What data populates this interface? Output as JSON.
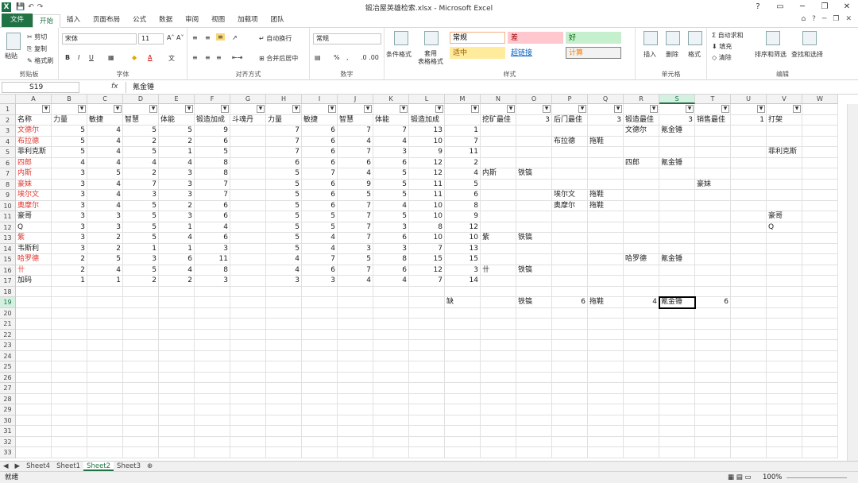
{
  "window": {
    "title": "锻冶屋英雄检索.xlsx - Microsoft Excel",
    "app_icon": "X"
  },
  "quick_access": {
    "save": "💾",
    "undo": "↶",
    "redo": "↷"
  },
  "tabs": [
    "文件",
    "开始",
    "插入",
    "页面布局",
    "公式",
    "数据",
    "审阅",
    "视图",
    "加载项",
    "团队"
  ],
  "ribbon": {
    "clipboard": {
      "label": "剪贴板",
      "paste": "粘贴",
      "cut": "剪切",
      "copy": "复制",
      "format_painter": "格式刷"
    },
    "font": {
      "label": "字体",
      "name": "宋体",
      "size": "11"
    },
    "alignment": {
      "label": "对齐方式",
      "wrap": "自动换行",
      "merge": "合并后居中"
    },
    "number": {
      "label": "数字",
      "format": "常规"
    },
    "styles": {
      "label": "样式",
      "conditional": "条件格式",
      "table": "套用\n表格格式",
      "items": [
        {
          "text": "常规",
          "bg": "#ffffff",
          "color": "#000000",
          "border": "#f4b183"
        },
        {
          "text": "差",
          "bg": "#ffc7ce",
          "color": "#9c0006",
          "border": "#ffc7ce"
        },
        {
          "text": "好",
          "bg": "#c6efce",
          "color": "#006100",
          "border": "#c6efce"
        },
        {
          "text": "适中",
          "bg": "#ffeb9c",
          "color": "#9c5700",
          "border": "#ffeb9c"
        },
        {
          "text": "超链接",
          "bg": "#ffffff",
          "color": "#0563c1",
          "border": "#ffffff"
        },
        {
          "text": "计算",
          "bg": "#f2f2f2",
          "color": "#fa7d00",
          "border": "#7f7f7f"
        }
      ]
    },
    "cells": {
      "label": "单元格",
      "insert": "插入",
      "delete": "删除",
      "format": "格式"
    },
    "editing": {
      "label": "编辑",
      "autosum": "自动求和",
      "fill": "填充",
      "clear": "清除",
      "sort": "排序和筛选",
      "find": "查找和选择"
    }
  },
  "formula_bar": {
    "name_box": "S19",
    "fx": "fx",
    "content": "氪金锤"
  },
  "columns": [
    "A",
    "B",
    "C",
    "D",
    "E",
    "F",
    "G",
    "H",
    "I",
    "J",
    "K",
    "L",
    "M",
    "N",
    "O",
    "P",
    "Q",
    "R",
    "S",
    "T",
    "U",
    "V",
    "W"
  ],
  "selected_col": "S",
  "rows": [
    {
      "r": 1,
      "cells": {}
    },
    {
      "r": 2,
      "cells": {
        "A": "名称",
        "B": "力量",
        "C": "敏捷",
        "D": "智慧",
        "E": "体能",
        "F": "锻造加成",
        "G": "斗魂丹",
        "H": "力量",
        "I": "敏捷",
        "J": "智慧",
        "K": "体能",
        "L": "锻造加成",
        "N": "挖矿最佳",
        "O": "3",
        "P": "后门最佳",
        "Q": "3",
        "R": "锻造最佳",
        "S": "3",
        "T": "销售最佳",
        "U": "1",
        "V": "打架"
      }
    },
    {
      "r": 3,
      "cells": {
        "A": "文德尔",
        "B": "5",
        "C": "4",
        "D": "5",
        "E": "5",
        "F": "9",
        "H": "7",
        "I": "6",
        "J": "7",
        "K": "7",
        "L": "13",
        "M": "1",
        "R": "文德尔",
        "S": "氪金锤"
      }
    },
    {
      "r": 4,
      "cells": {
        "A": "布拉德",
        "B": "5",
        "C": "4",
        "D": "2",
        "E": "2",
        "F": "6",
        "H": "7",
        "I": "6",
        "J": "4",
        "K": "4",
        "L": "10",
        "M": "7",
        "P": "布拉德",
        "Q": "拖鞋"
      }
    },
    {
      "r": 5,
      "cells": {
        "A": "菲利克斯",
        "B": "5",
        "C": "4",
        "D": "5",
        "E": "1",
        "F": "5",
        "H": "7",
        "I": "6",
        "J": "7",
        "K": "3",
        "L": "9",
        "M": "11",
        "V": "菲利克斯"
      }
    },
    {
      "r": 6,
      "cells": {
        "A": "四郎",
        "B": "4",
        "C": "4",
        "D": "4",
        "E": "4",
        "F": "8",
        "H": "6",
        "I": "6",
        "J": "6",
        "K": "6",
        "L": "12",
        "M": "2",
        "R": "四郎",
        "S": "氪金锤"
      }
    },
    {
      "r": 7,
      "cells": {
        "A": "内斯",
        "B": "3",
        "C": "5",
        "D": "2",
        "E": "3",
        "F": "8",
        "H": "5",
        "I": "7",
        "J": "4",
        "K": "5",
        "L": "12",
        "M": "4",
        "N": "内斯",
        "O": "铁镐"
      }
    },
    {
      "r": 8,
      "cells": {
        "A": "豪妹",
        "B": "3",
        "C": "4",
        "D": "7",
        "E": "3",
        "F": "7",
        "H": "5",
        "I": "6",
        "J": "9",
        "K": "5",
        "L": "11",
        "M": "5",
        "T": "豪妹"
      }
    },
    {
      "r": 9,
      "cells": {
        "A": "埃尔文",
        "B": "3",
        "C": "4",
        "D": "3",
        "E": "3",
        "F": "7",
        "H": "5",
        "I": "6",
        "J": "5",
        "K": "5",
        "L": "11",
        "M": "6",
        "P": "埃尔文",
        "Q": "拖鞋"
      }
    },
    {
      "r": 10,
      "cells": {
        "A": "奥摩尔",
        "B": "3",
        "C": "4",
        "D": "5",
        "E": "2",
        "F": "6",
        "H": "5",
        "I": "6",
        "J": "7",
        "K": "4",
        "L": "10",
        "M": "8",
        "P": "奥摩尔",
        "Q": "拖鞋"
      }
    },
    {
      "r": 11,
      "cells": {
        "A": "豪哥",
        "B": "3",
        "C": "3",
        "D": "5",
        "E": "3",
        "F": "6",
        "H": "5",
        "I": "5",
        "J": "7",
        "K": "5",
        "L": "10",
        "M": "9",
        "V": "豪哥"
      }
    },
    {
      "r": 12,
      "cells": {
        "A": "Q",
        "B": "3",
        "C": "3",
        "D": "5",
        "E": "1",
        "F": "4",
        "H": "5",
        "I": "5",
        "J": "7",
        "K": "3",
        "L": "8",
        "M": "12",
        "V": "Q"
      }
    },
    {
      "r": 13,
      "cells": {
        "A": "紫",
        "B": "3",
        "C": "2",
        "D": "5",
        "E": "4",
        "F": "6",
        "H": "5",
        "I": "4",
        "J": "7",
        "K": "6",
        "L": "10",
        "M": "10",
        "N": "紫",
        "O": "铁镐"
      }
    },
    {
      "r": 14,
      "cells": {
        "A": "韦斯利",
        "B": "3",
        "C": "2",
        "D": "1",
        "E": "1",
        "F": "3",
        "H": "5",
        "I": "4",
        "J": "3",
        "K": "3",
        "L": "7",
        "M": "13"
      }
    },
    {
      "r": 15,
      "cells": {
        "A": "哈罗德",
        "B": "2",
        "C": "5",
        "D": "3",
        "E": "6",
        "F": "11",
        "H": "4",
        "I": "7",
        "J": "5",
        "K": "8",
        "L": "15",
        "M": "15",
        "R": "哈罗德",
        "S": "氪金锤"
      }
    },
    {
      "r": 16,
      "cells": {
        "A": "卄",
        "B": "2",
        "C": "4",
        "D": "5",
        "E": "4",
        "F": "8",
        "H": "4",
        "I": "6",
        "J": "7",
        "K": "6",
        "L": "12",
        "M": "3",
        "N": "卄",
        "O": "铁镐"
      }
    },
    {
      "r": 17,
      "cells": {
        "A": "加码",
        "B": "1",
        "C": "1",
        "D": "2",
        "E": "2",
        "F": "3",
        "H": "3",
        "I": "3",
        "J": "4",
        "K": "4",
        "L": "7",
        "M": "14"
      }
    },
    {
      "r": 18,
      "cells": {}
    },
    {
      "r": 19,
      "cells": {
        "M": "缺",
        "O": "铁镐",
        "P": "6",
        "Q": "拖鞋",
        "R": "4",
        "S": "氪金锤",
        "T": "6"
      }
    },
    {
      "r": 20,
      "cells": {}
    },
    {
      "r": 21,
      "cells": {}
    },
    {
      "r": 22,
      "cells": {}
    },
    {
      "r": 23,
      "cells": {}
    },
    {
      "r": 24,
      "cells": {}
    },
    {
      "r": 25,
      "cells": {}
    },
    {
      "r": 26,
      "cells": {}
    },
    {
      "r": 27,
      "cells": {}
    },
    {
      "r": 28,
      "cells": {}
    },
    {
      "r": 29,
      "cells": {}
    },
    {
      "r": 30,
      "cells": {}
    },
    {
      "r": 31,
      "cells": {}
    },
    {
      "r": 32,
      "cells": {}
    },
    {
      "r": 33,
      "cells": {}
    }
  ],
  "red_names": [
    "文德尔",
    "布拉德",
    "四郎",
    "内斯",
    "豪妹",
    "埃尔文",
    "奥摩尔",
    "紫",
    "哈罗德",
    "卄"
  ],
  "selected_cell": "S19",
  "sheets": [
    "Sheet4",
    "Sheet1",
    "Sheet2",
    "Sheet3"
  ],
  "active_sheet": "Sheet2",
  "status": {
    "ready": "就绪",
    "zoom": "100%"
  },
  "colors": {
    "accent": "#217346",
    "red_text": "#e0332b"
  }
}
